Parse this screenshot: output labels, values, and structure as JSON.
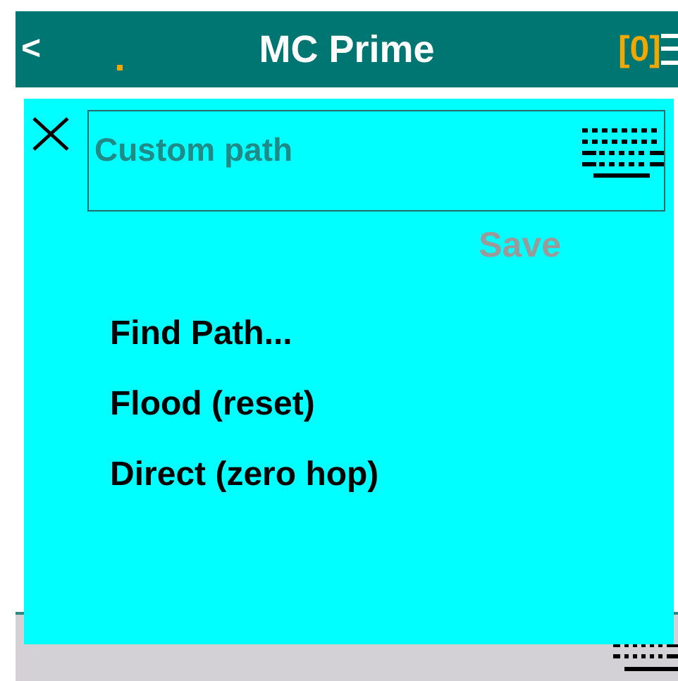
{
  "header": {
    "back": "<",
    "title": "MC Prime",
    "count": "[0]"
  },
  "dialog": {
    "path_field": {
      "placeholder": "Custom path"
    },
    "save_button": {
      "label": "Save",
      "disabled": true
    },
    "menu": [
      {
        "label": "Find Path..."
      },
      {
        "label": "Flood (reset)"
      },
      {
        "label": "Direct (zero hop)"
      }
    ]
  }
}
